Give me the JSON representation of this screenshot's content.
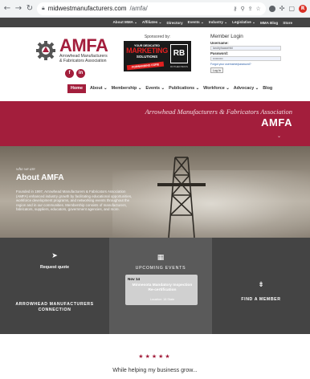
{
  "browser": {
    "url_host": "midwestmanufacturers.com",
    "url_path": "/amfa/",
    "icons": [
      "back-icon",
      "forward-icon",
      "reload-icon",
      "lock-icon",
      "key-icon",
      "zoom-icon",
      "share-icon",
      "star-icon",
      "extension-icon",
      "puzzle-icon",
      "sidebar-icon",
      "profile-avatar"
    ]
  },
  "utility_nav": [
    "About MMA ⌄",
    "Affiliates ⌄",
    "Directory",
    "Events ⌄",
    "Industry ⌄",
    "Legislative ⌄",
    "MMA Blog",
    "Store"
  ],
  "logo": {
    "name": "AMFA",
    "sub1": "Arrowhead Manufacturers",
    "sub2": "& Fabricators Association",
    "social": [
      "f",
      "in"
    ]
  },
  "sponsor": {
    "label": "Sponsored by:",
    "ad_top": "YOUR DEDICATED",
    "ad_big": "MARKETING",
    "ad_mid": "SOLUTIONS",
    "ad_banner": "FORWARDING CORE",
    "ad_logo": "RB",
    "ad_logo_sub": "ROTHER BROS"
  },
  "login": {
    "title": "Member Login",
    "username_label": "Username:",
    "username_value": "landryhaasehfd",
    "password_label": "Password:",
    "password_value": "••••••••••",
    "forgot": "Forgot your username/password?",
    "button": "Log In"
  },
  "main_nav": {
    "home": "Home",
    "items": [
      "About ⌄",
      "Membership ⌄",
      "Events ⌄",
      "Publications ⌄",
      "Workforce ⌄",
      "Advocacy ⌄",
      "Blog"
    ]
  },
  "hero": {
    "tagline": "Arrowhead Manufacturers & Fabricators Association",
    "name": "AMFA",
    "chevron": "⌄"
  },
  "about": {
    "eyebrow": "who we are",
    "title": "About AMFA",
    "text": "Founded in 1997, Arrowhead Manufacturers & Fabricators Association (AMFA) enhanced industry growth by facilitating educational opportunities, workforce development programs, and networking events throughout the region and in our communities. Membership consists of manufacturers, fabricators, suppliers, educators, government agencies, and more."
  },
  "columns": {
    "left": {
      "icon": "➤",
      "line1": "Request quote",
      "line2": "ARROWHEAD MANUFACTURERS CONNECTION"
    },
    "mid": {
      "icon": "▦",
      "heading": "UPCOMING EVENTS",
      "event_date": "Nov 14",
      "event_title": "Minnesota Mandatory Inspection Re-certification",
      "event_location": "Location: 18 State"
    },
    "right": {
      "icon": "⇟",
      "line1": "FIND A MEMBER"
    }
  },
  "testimonial": {
    "stars": "★★★★★",
    "quote": "While helping my business grow..."
  }
}
